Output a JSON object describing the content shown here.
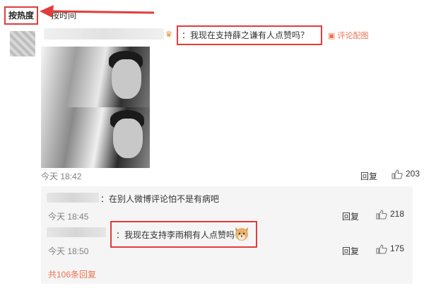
{
  "sort_bar": {
    "hot_label": "按热度",
    "time_label": "按时间"
  },
  "comment": {
    "text": "：我现在支持薛之谦有人点赞吗？",
    "with_pic": "评论配图",
    "timestamp": "今天 18:42",
    "reply_label": "回复",
    "likes": "203"
  },
  "replies": [
    {
      "text": "：在别人微博评论怕不是有病吧",
      "timestamp": "今天 18:45",
      "reply_label": "回复",
      "likes": "218"
    },
    {
      "text": "：我现在支持李雨桐有人点赞吗",
      "timestamp": "今天 18:50",
      "reply_label": "回复",
      "likes": "175"
    }
  ],
  "more_replies": "共106条回复",
  "colors": {
    "highlight": "#e23c3c",
    "accent": "#eb7350"
  }
}
